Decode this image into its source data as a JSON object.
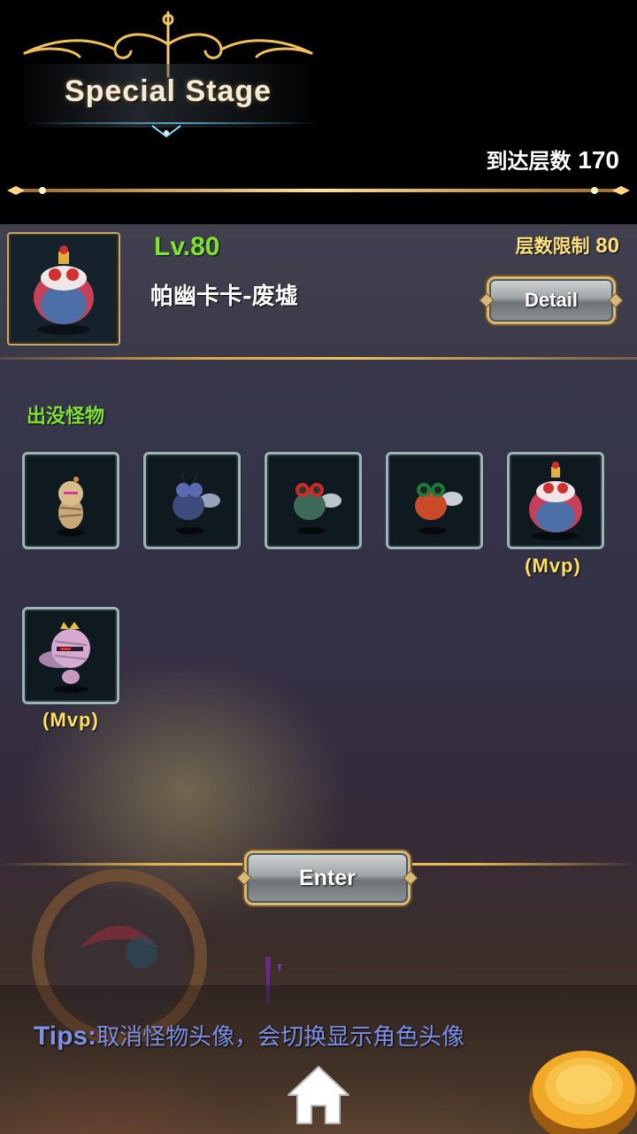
{
  "header": {
    "title": "Special Stage",
    "floors_reached_label": "到达层数",
    "floors_reached_value": "170"
  },
  "stage": {
    "level": "Lv.80",
    "name": "帕幽卡卡-废墟",
    "floor_limit_label": "层数限制",
    "floor_limit_value": "80",
    "detail_label": "Detail"
  },
  "monsters": {
    "label": "出没怪物",
    "items": [
      {
        "name": "mummy-small",
        "mvp": ""
      },
      {
        "name": "fly-blue",
        "mvp": ""
      },
      {
        "name": "fly-green",
        "mvp": ""
      },
      {
        "name": "fly-red",
        "mvp": ""
      },
      {
        "name": "king-fly-boss",
        "mvp": "(Mvp)"
      },
      {
        "name": "mummy-king",
        "mvp": "(Mvp)"
      }
    ]
  },
  "actions": {
    "enter_label": "Enter"
  },
  "tips": {
    "key": "Tips:",
    "text": "取消怪物头像，会切换显示角色头像"
  },
  "colors": {
    "accent_green": "#7ee22f",
    "accent_gold": "#ffe27a",
    "tips_blue": "#7d8fe6"
  },
  "icons": [
    "ornament-icon",
    "home-icon"
  ]
}
